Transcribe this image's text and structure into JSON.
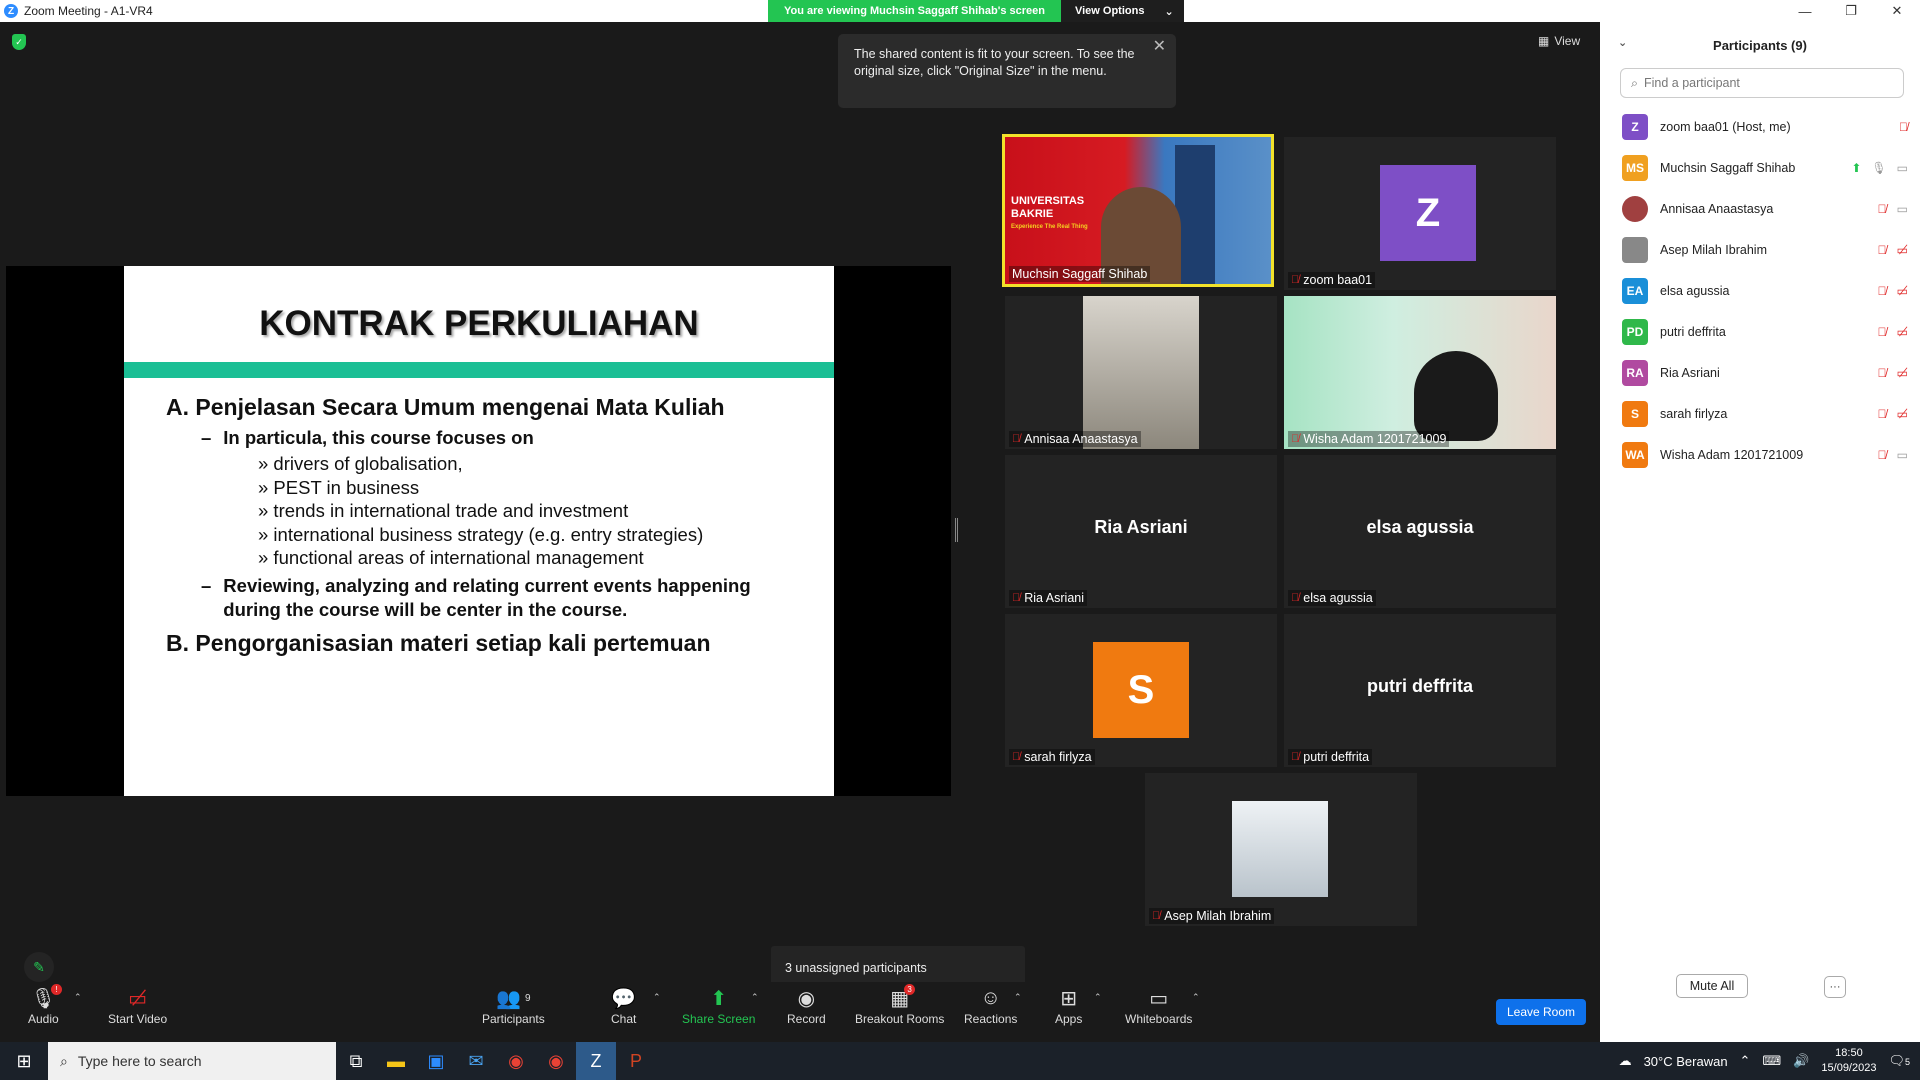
{
  "window": {
    "title": "Zoom Meeting - A1-VR4",
    "controls": [
      "—",
      "❐",
      "✕"
    ]
  },
  "banner": {
    "viewing_text": "You are viewing Muchsin Saggaff Shihab's screen",
    "view_options": "View Options"
  },
  "view_button": "View",
  "tooltip": {
    "text": "The shared content is fit to your screen. To see the original size, click \"Original Size\" in the menu."
  },
  "slide": {
    "title": "KONTRAK PERKULIAHAN",
    "a_heading": "A. Penjelasan Secara Umum mengenai Mata Kuliah",
    "sub1": "In particula, this course focuses on",
    "items": [
      "» drivers of globalisation,",
      "» PEST in business",
      "» trends in international trade and investment",
      "» international business strategy (e.g. entry strategies)",
      "» functional areas of international management"
    ],
    "sub2_line1": "Reviewing, analyzing and relating current events happening",
    "sub2_line2": "during the course will be center in the course.",
    "b_heading": "B. Pengorganisasian materi setiap kali pertemuan"
  },
  "tiles": [
    {
      "name": "Muchsin Saggaff Shihab",
      "overlay_line1": "UNIVERSITAS",
      "overlay_line2": "BAKRIE",
      "overlay_tag": "Experience The Real Thing"
    },
    {
      "name": "zoom baa01",
      "avatar": "Z",
      "color": "#7e4fc6"
    },
    {
      "name": "Annisaa Anaastasya"
    },
    {
      "name": "Wisha Adam 1201721009"
    },
    {
      "name": "Ria Asriani",
      "big": "Ria Asriani"
    },
    {
      "name": "elsa agussia",
      "big": "elsa agussia"
    },
    {
      "name": "sarah firlyza",
      "avatar": "S",
      "color": "#f07a10"
    },
    {
      "name": "putri deffrita",
      "big": "putri deffrita"
    },
    {
      "name": "Asep Milah Ibrahim"
    }
  ],
  "toolbar": {
    "audio": "Audio",
    "start_video": "Start Video",
    "participants": "Participants",
    "participants_count": "9",
    "chat": "Chat",
    "share_screen": "Share Screen",
    "record": "Record",
    "breakout_rooms": "Breakout Rooms",
    "breakout_count": "3",
    "reactions": "Reactions",
    "apps": "Apps",
    "whiteboards": "Whiteboards",
    "leave": "Leave Room"
  },
  "unassigned": "3 unassigned participants",
  "panel": {
    "title": "Participants (9)",
    "search_placeholder": "Find a participant",
    "participants": [
      {
        "initials": "Z",
        "name": "zoom baa01 (Host, me)",
        "color": "#7e4fc6"
      },
      {
        "initials": "MS",
        "name": "Muchsin Saggaff Shihab",
        "color": "#f0a020"
      },
      {
        "initials": "",
        "name": "Annisaa Anaastasya",
        "color": "#a04040"
      },
      {
        "initials": "",
        "name": "Asep Milah Ibrahim",
        "color": "#888888"
      },
      {
        "initials": "EA",
        "name": "elsa agussia",
        "color": "#1a8fd8"
      },
      {
        "initials": "PD",
        "name": "putri deffrita",
        "color": "#2fb84a"
      },
      {
        "initials": "RA",
        "name": "Ria Asriani",
        "color": "#b04aa0"
      },
      {
        "initials": "S",
        "name": "sarah firlyza",
        "color": "#f07a10"
      },
      {
        "initials": "WA",
        "name": "Wisha Adam 1201721009",
        "color": "#f07a10"
      }
    ],
    "mute_all": "Mute All",
    "more": "···"
  },
  "taskbar": {
    "search_placeholder": "Type here to search",
    "weather": "30°C Berawan",
    "time": "18:50",
    "date": "15/09/2023",
    "notif_count": "5"
  }
}
